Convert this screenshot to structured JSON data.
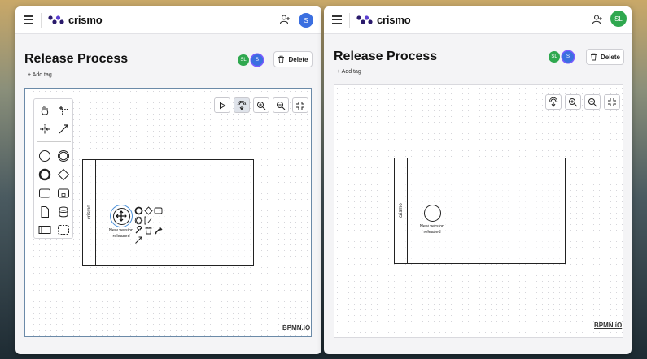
{
  "app": {
    "name": "crismo",
    "brand_color": "#2a1a6b",
    "menu_icon": "hamburger-menu-icon",
    "add_user_icon": "add-user-icon"
  },
  "left_window": {
    "user_avatar": {
      "initials": "S",
      "color": "#3b6fe0"
    },
    "title": "Release Process",
    "add_tag": "+ Add tag",
    "delete_label": "Delete",
    "collaborators": [
      {
        "initials": "SL",
        "color": "#2fa84f"
      },
      {
        "initials": "S",
        "color": "#3b6fe0"
      }
    ],
    "pool_label": "crismo",
    "event_label_line1": "New version",
    "event_label_line2": "released",
    "watermark": "BPMN.iO",
    "toolbar": [
      "play-icon",
      "touch-icon",
      "zoom-in-icon",
      "zoom-out-icon",
      "fit-screen-icon"
    ]
  },
  "right_window": {
    "user_avatar": {
      "initials": "SL",
      "color": "#2fa84f"
    },
    "title": "Release Process",
    "add_tag": "+ Add tag",
    "delete_label": "Delete",
    "collaborators": [
      {
        "initials": "SL",
        "color": "#2fa84f"
      },
      {
        "initials": "S",
        "color": "#3b6fe0"
      }
    ],
    "pool_label": "crismo",
    "event_label_line1": "New version",
    "event_label_line2": "released",
    "watermark": "BPMN.iO",
    "toolbar": [
      "touch-icon",
      "zoom-in-icon",
      "zoom-out-icon",
      "fit-screen-icon"
    ]
  }
}
